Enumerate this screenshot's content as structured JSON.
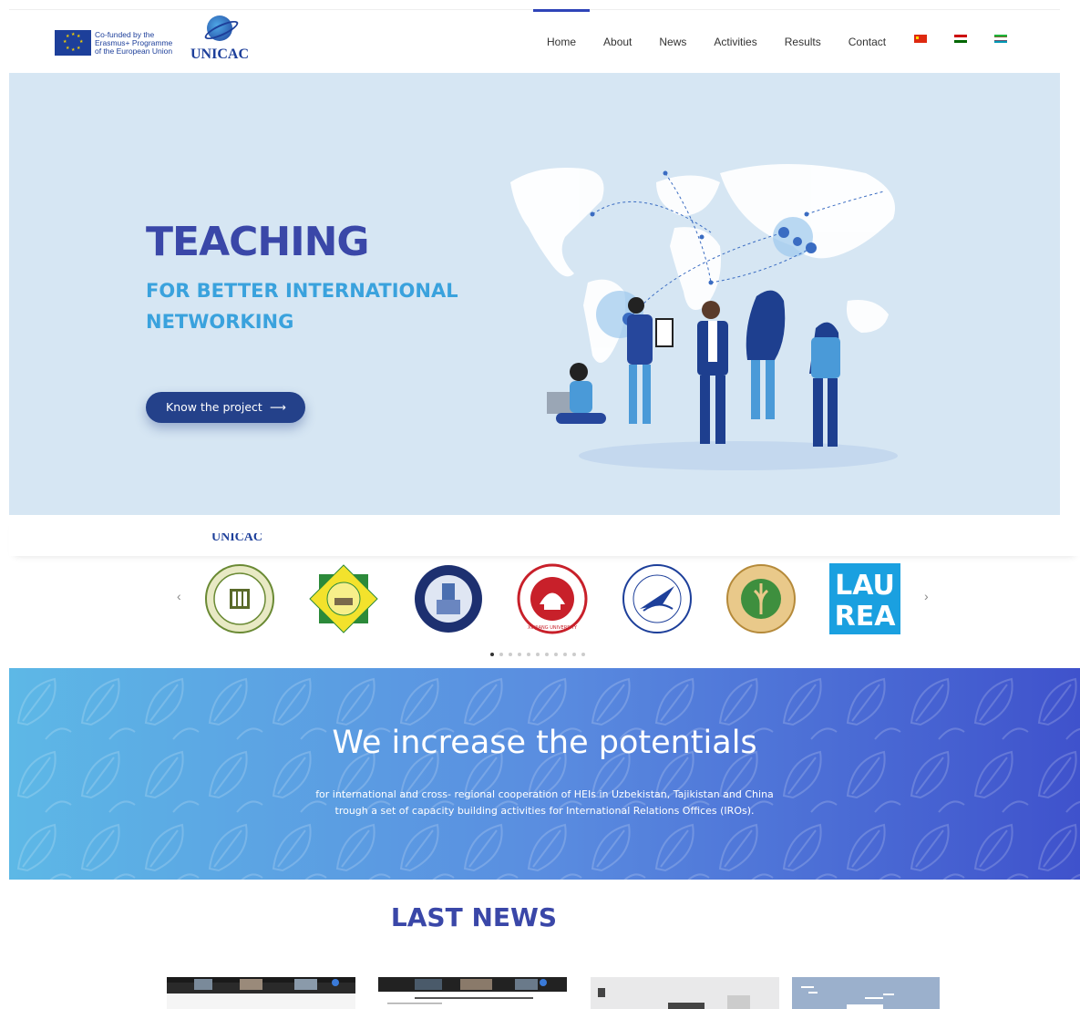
{
  "header": {
    "eu_text": [
      "Co-funded by the",
      "Erasmus+ Programme",
      "of the European Union"
    ],
    "logo_text": "UNICAC",
    "nav": [
      {
        "label": "Home",
        "active": true
      },
      {
        "label": "About",
        "active": false
      },
      {
        "label": "News",
        "active": false
      },
      {
        "label": "Activities",
        "active": false
      },
      {
        "label": "Results",
        "active": false
      },
      {
        "label": "Contact",
        "active": false
      }
    ],
    "flags": [
      "flag-cn-icon",
      "flag-tj-icon",
      "flag-uz-icon"
    ]
  },
  "hero": {
    "title": "TEACHING",
    "subtitle": "FOR BETTER INTERNATIONAL NETWORKING",
    "button_label": "Know the project",
    "button_arrow": "⟶"
  },
  "partners": {
    "cut_title": "UNICAC",
    "prev": "‹",
    "next": "›",
    "logos": [
      {
        "name": "partner-logo-1",
        "text": ""
      },
      {
        "name": "partner-logo-2",
        "text": ""
      },
      {
        "name": "partner-logo-3",
        "text": ""
      },
      {
        "name": "partner-logo-xinjiang",
        "text": "XINJIANG UNIVERSITY"
      },
      {
        "name": "partner-logo-northwestern",
        "text": ""
      },
      {
        "name": "partner-logo-nw-af",
        "text": ""
      },
      {
        "name": "partner-logo-laurea",
        "text": "LAU REA"
      }
    ],
    "dots_count": 11,
    "active_dot": 0
  },
  "banner": {
    "title": "We increase the potentials",
    "line1": "for international and cross- regional cooperation of HEIs in Uzbekistan, Tajikistan and China",
    "line2": "trough a set of capacity building activities for International Relations Offices (IROs)."
  },
  "news": {
    "title": "LAST NEWS"
  },
  "colors": {
    "brand_dark": "#24418a",
    "brand_title": "#3a47a8",
    "brand_light": "#3aa2dd",
    "hero_bg": "#d6e6f3"
  }
}
